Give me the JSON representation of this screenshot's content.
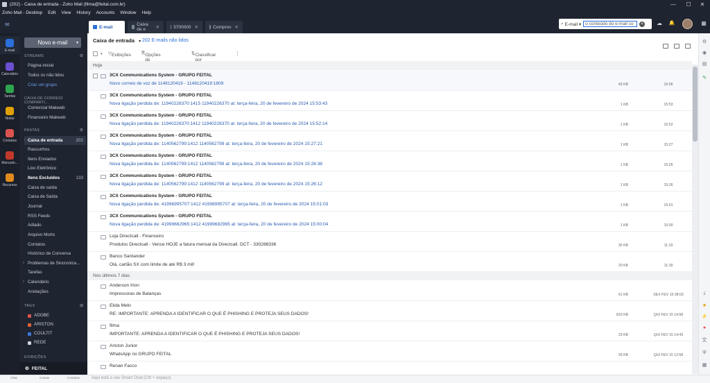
{
  "window": {
    "title": "(202) - Caixa de entrada - Zoho Mail (filma@feital.com.br)",
    "min_icon": "—",
    "max_icon": "☐",
    "close_icon": "✕"
  },
  "menu": [
    "Zoho Mail - Desktop",
    "Edit",
    "View",
    "History",
    "Accounts",
    "Window",
    "Help"
  ],
  "tabs": [
    {
      "label": "E-mail"
    },
    {
      "label": "Caixa de e"
    },
    {
      "label": "5700000"
    },
    {
      "label": "Comprov"
    }
  ],
  "tab_close": "✕",
  "search": {
    "scope": "E-mail ▾",
    "query": "o conteúdo do e-mail co",
    "clear": "×"
  },
  "top_icons": {
    "cloud": "☁",
    "bell": "🔔",
    "apps": "▦"
  },
  "rail": [
    {
      "label": "E-mail",
      "color": "#2a6fdb"
    },
    {
      "label": "Calendário",
      "color": "#6b4fcf"
    },
    {
      "label": "Tarefas",
      "color": "#2ea44f"
    },
    {
      "label": "Notas",
      "color": "#e0a100"
    },
    {
      "label": "Contatos",
      "color": "#d9534f"
    },
    {
      "label": "Marcado...",
      "color": "#c0392b"
    },
    {
      "label": "Recursos",
      "color": "#e08a1e"
    }
  ],
  "sidebar": {
    "new_mail": "Novo e-mail",
    "new_mail_dd": "▾",
    "streams_header": "STREAMS",
    "streams_items": [
      "Página inicial",
      "Todos os não lidos"
    ],
    "create_group": "Criar um grupo",
    "shared_header": "CAIXA DE CORREIO COMPARTI...",
    "shared_items": [
      "Comercial Makweb",
      "Financeiro Makweb"
    ],
    "folders_header": "PASTAS",
    "folders": [
      {
        "label": "Caixa de entrada",
        "count": "202",
        "bold": true
      },
      {
        "label": "Rascunhos",
        "count": ""
      },
      {
        "label": "Itens Enviados",
        "count": ""
      },
      {
        "label": "Lixo Eletrônico",
        "count": ""
      },
      {
        "label": "Itens Excluídos",
        "count": "133",
        "bold": true
      },
      {
        "label": "Caixa de saída",
        "count": ""
      },
      {
        "label": "Caixa de Saída",
        "count": ""
      },
      {
        "label": "Journal",
        "count": ""
      },
      {
        "label": "RSS Feeds",
        "count": ""
      },
      {
        "label": "Adiado",
        "count": ""
      },
      {
        "label": "Arquivo Morto",
        "count": ""
      },
      {
        "label": "Contatos",
        "count": ""
      },
      {
        "label": "Histórico de Conversa",
        "count": ""
      },
      {
        "label": "Problemas de Sincroniza...",
        "count": ""
      },
      {
        "label": "Tarefas",
        "count": ""
      },
      {
        "label": "Calendário",
        "count": ""
      },
      {
        "label": "Anotações",
        "count": ""
      }
    ],
    "tags_header": "TAGS",
    "tags": [
      {
        "label": "ADOBE",
        "color": "#d9534f"
      },
      {
        "label": "ARISTON",
        "color": "#e0643a"
      },
      {
        "label": "COULTIT",
        "color": "#3a78d9"
      },
      {
        "label": "REDE",
        "color": "#cfd4dc"
      }
    ],
    "views_header": "EXIBIÇÕES",
    "account": "FEITAL"
  },
  "main": {
    "folder": "Caixa de entrada",
    "folder_dd": "▾",
    "unread": "202 E-mails não lidos",
    "toolbar": {
      "views": "Exibições",
      "attach": "Opções de anexo",
      "sort": "Classificar por",
      "more": "⋮"
    },
    "groups": {
      "today": "Hoje",
      "last7": "Nos últimos 7 dias"
    },
    "emails": [
      {
        "sender": "3CX Communications System - GRUPO FEITAL",
        "subject": "Novo correio de voz de 1148120419 - 1148120419:1809",
        "size": "43 KB",
        "time": "16:06",
        "unread": true
      },
      {
        "sender": "3CX Communications System - GRUPO FEITAL",
        "subject": "Nova ligação perdida de: 11940226370:1415 11940226370 at: terça-feira, 20 de fevereiro de 2024 15:53:43",
        "size": "1 KB",
        "time": "15:53",
        "unread": true
      },
      {
        "sender": "3CX Communications System - GRUPO FEITAL",
        "subject": "Nova ligação perdida de: 11940226370:1412 11940226370 at: terça-feira, 20 de fevereiro de 2024 15:52:14",
        "size": "1 KB",
        "time": "15:52",
        "unread": true
      },
      {
        "sender": "3CX Communications System - GRUPO FEITAL",
        "subject": "Nova ligação perdida de: 1140562799:1412 1140562799 at: terça-feira, 20 de fevereiro de 2024 15:27:21",
        "size": "1 KB",
        "time": "15:27",
        "unread": true
      },
      {
        "sender": "3CX Communications System - GRUPO FEITAL",
        "subject": "Nova ligação perdida de: 1140562799:1412 1140562799 at: terça-feira, 20 de fevereiro de 2024 15:26:38",
        "size": "1 KB",
        "time": "15:26",
        "unread": true
      },
      {
        "sender": "3CX Communications System - GRUPO FEITAL",
        "subject": "Nova ligação perdida de: 1140562799:1412 1140562799 at: terça-feira, 20 de fevereiro de 2024 15:26:12",
        "size": "1 KB",
        "time": "15:26",
        "unread": true
      },
      {
        "sender": "3CX Communications System - GRUPO FEITAL",
        "subject": "Nova ligação perdida de: 41996995707:1412 41996995707 at: terça-feira, 20 de fevereiro de 2024 15:01:03",
        "size": "1 KB",
        "time": "15:01",
        "unread": true
      },
      {
        "sender": "3CX Communications System - GRUPO FEITAL",
        "subject": "Nova ligação perdida de: 41999682965:1412 41999682965 at: terça-feira, 20 de fevereiro de 2024 15:00:04",
        "size": "1 KB",
        "time": "15:00",
        "unread": true
      },
      {
        "sender": "Loja Directcall - Financeiro",
        "subject": "Produtos Directcall - Vence HOJE a fatura mensal da Directcall. DCT - 330286336",
        "size": "35 KB",
        "time": "11:19",
        "unread": false
      },
      {
        "sender": "Banco Santander",
        "subject": "Olá, cartão SX com limite de até R$ 3 mil!",
        "size": "20 KB",
        "time": "11:18",
        "unread": false
      },
      {
        "sender": "Anderson Irion",
        "subject": "Impressoras de Balanças",
        "size": "61 KB",
        "time": "SEX FEV 16 08:03",
        "unread": false
      },
      {
        "sender": "Elida Melo",
        "subject": "RE: IMPORTANTE: APRENDA A IDENTIFICAR O QUE É PHISHING E PROTEJA SEUS DADOS!",
        "size": "810 KB",
        "time": "QUI FEV 15 14:58",
        "unread": false
      },
      {
        "sender": "filma",
        "subject": "IMPORTANTE: APRENDA A IDENTIFICAR O QUE É PHISHING E PROTEJA SEUS DADOS!",
        "size": "23 KB",
        "time": "QUI FEV 15 14:43",
        "unread": false
      },
      {
        "sender": "Ariston Junior",
        "subject": "WhatsApp no GRUPO FEITAL",
        "size": "26 KB",
        "time": "QUI FEV 15 12:58",
        "unread": false
      },
      {
        "sender": "Renan Facco",
        "subject": "",
        "size": "",
        "time": "",
        "unread": false
      }
    ]
  },
  "bottom": {
    "chat_hint": "Aqui está o seu Smart Chat (Ctrl + espaço)",
    "items": [
      "Chat",
      "Canais",
      "Contatos"
    ]
  }
}
